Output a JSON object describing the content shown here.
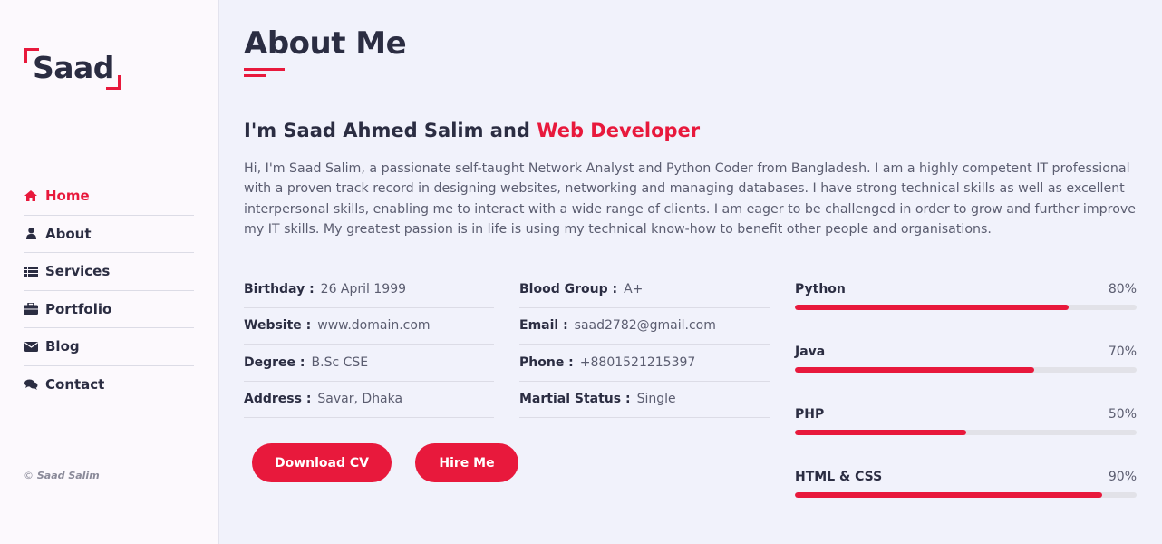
{
  "brand": {
    "name": "Saad",
    "accent": "#e8193c"
  },
  "nav": [
    {
      "label": "Home",
      "icon": "home-icon",
      "active": true
    },
    {
      "label": "About",
      "icon": "user-icon",
      "active": false
    },
    {
      "label": "Services",
      "icon": "list-icon",
      "active": false
    },
    {
      "label": "Portfolio",
      "icon": "briefcase-icon",
      "active": false
    },
    {
      "label": "Blog",
      "icon": "envelope-icon",
      "active": false
    },
    {
      "label": "Contact",
      "icon": "comments-icon",
      "active": false
    }
  ],
  "copyright": {
    "symbol": "©",
    "name": "Saad Salim"
  },
  "page": {
    "title": "About Me",
    "heading_prefix": "I'm Saad Ahmed Salim and",
    "heading_accent": "Web Developer",
    "bio": "Hi, I'm Saad Salim, a passionate self-taught Network Analyst and Python Coder from Bangladesh. I am a highly competent IT professional with a proven track record in designing websites, networking and managing databases. I have strong technical skills as well as excellent interpersonal skills, enabling me to interact with a wide range of clients. I am eager to be challenged in order to grow and further improve my IT skills. My greatest passion is in life is using my technical know-how to benefit other people and organisations."
  },
  "info_left": [
    {
      "label": "Birthday :",
      "value": "26 April 1999"
    },
    {
      "label": "Website :",
      "value": "www.domain.com"
    },
    {
      "label": "Degree :",
      "value": "B.Sc CSE"
    },
    {
      "label": "Address :",
      "value": "Savar, Dhaka"
    }
  ],
  "info_right": [
    {
      "label": "Blood Group :",
      "value": "A+"
    },
    {
      "label": "Email :",
      "value": "saad2782@gmail.com"
    },
    {
      "label": "Phone :",
      "value": "+8801521215397"
    },
    {
      "label": "Martial Status :",
      "value": "Single"
    }
  ],
  "buttons": {
    "download": "Download CV",
    "hire": "Hire Me"
  },
  "skills": [
    {
      "name": "Python",
      "percent_label": "80%",
      "value": 0.8
    },
    {
      "name": "Java",
      "percent_label": "70%",
      "value": 0.7
    },
    {
      "name": "PHP",
      "percent_label": "50%",
      "value": 0.5
    },
    {
      "name": "HTML & CSS",
      "percent_label": "90%",
      "value": 0.9
    }
  ]
}
